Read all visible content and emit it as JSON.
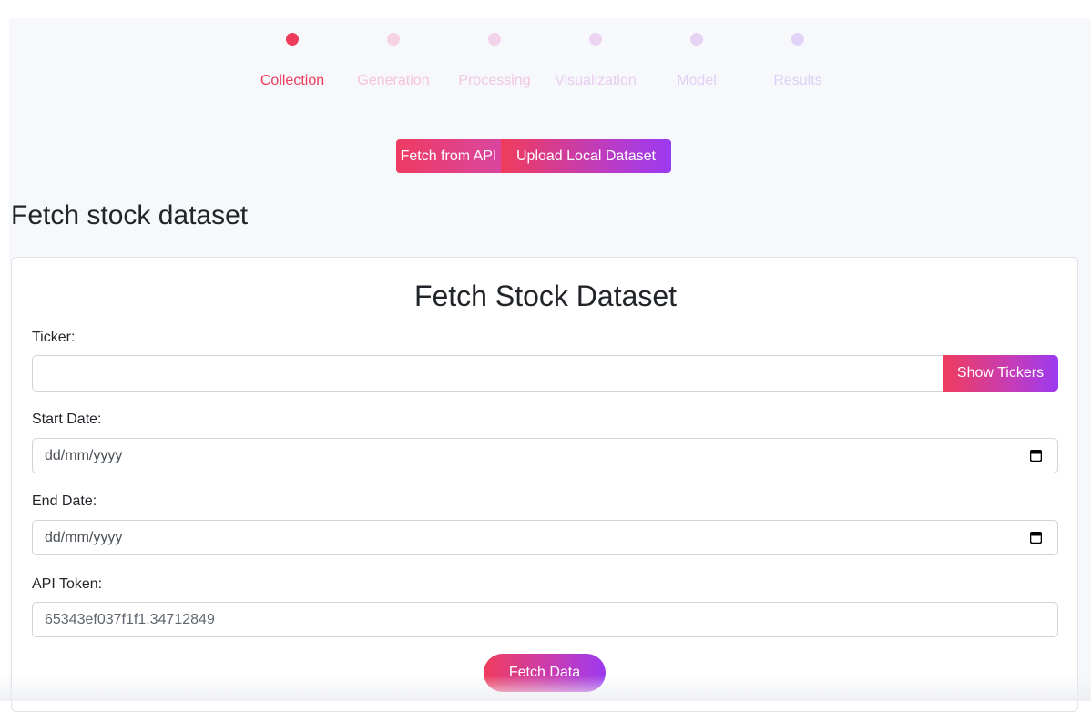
{
  "stepper": {
    "steps": [
      {
        "label": "Collection",
        "color": "#ee3b5b",
        "text_color": "#ee3b5b"
      },
      {
        "label": "Generation",
        "color": "#f7d3e1",
        "text_color": "#f7c4d6"
      },
      {
        "label": "Processing",
        "color": "#f3d3ea",
        "text_color": "#f0c8e2"
      },
      {
        "label": "Visualization",
        "color": "#ecd3f0",
        "text_color": "#e8cdef"
      },
      {
        "label": "Model",
        "color": "#e6d3f4",
        "text_color": "#e2cff3"
      },
      {
        "label": "Results",
        "color": "#e1d3f7",
        "text_color": "#dfd0f6"
      }
    ]
  },
  "source_toggle": {
    "api_label": "Fetch from API",
    "upload_label": "Upload Local Dataset"
  },
  "page_title": "Fetch stock dataset",
  "form": {
    "title": "Fetch Stock Dataset",
    "ticker": {
      "label": "Ticker:",
      "value": "",
      "button_label": "Show Tickers"
    },
    "start_date": {
      "label": "Start Date:",
      "placeholder": "dd/mm/yyyy"
    },
    "end_date": {
      "label": "End Date:",
      "placeholder": "dd/mm/yyyy"
    },
    "api_token": {
      "label": "API Token:",
      "value": "65343ef037f1f1.34712849"
    },
    "submit_label": "Fetch Data"
  },
  "colors": {
    "accent_start": "#f03c5c",
    "accent_end": "#9b3af0"
  }
}
